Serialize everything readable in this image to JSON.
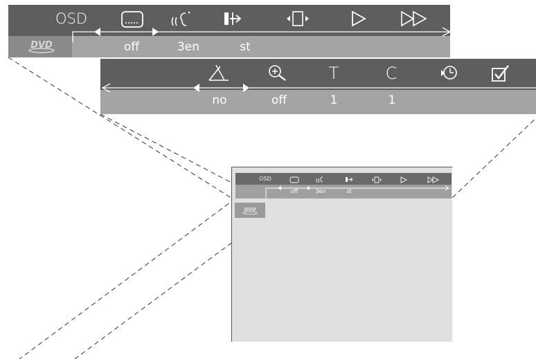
{
  "osd": {
    "title": "OSD",
    "row1_values": {
      "subtitles": "off",
      "audio": "3en",
      "sound": "st"
    },
    "row2_values": {
      "angle": "no",
      "zoom": "off",
      "title": "1",
      "chapter": "1"
    },
    "row2_labels": {
      "title": "T",
      "chapter": "C"
    }
  },
  "mini": {
    "title": "OSD",
    "values": {
      "subtitles": "off",
      "audio": "3en",
      "sound": "st"
    }
  },
  "icons": [
    "dvd-logo-icon",
    "subtitle-icon",
    "audio-language-icon",
    "sound-mode-icon",
    "frame-step-icon",
    "play-icon",
    "fast-forward-icon",
    "angle-icon",
    "zoom-icon",
    "time-search-icon",
    "checkmark-icon"
  ],
  "colors": {
    "bar_dark": "#5e5e5e",
    "bar_light": "#a4a4a4",
    "screen": "#e0e0e0"
  }
}
